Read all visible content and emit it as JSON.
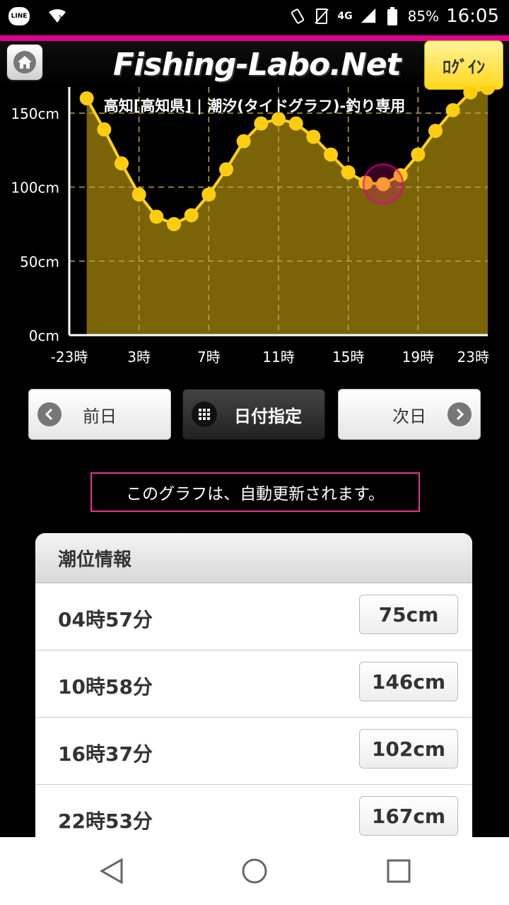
{
  "status_bar": {
    "line_label": "LINE",
    "network": "4G",
    "battery": "85%",
    "time": "16:05"
  },
  "header": {
    "logo": "Fishing-Labo.Net",
    "login_label": "ﾛｸﾞｲﾝ"
  },
  "chart_title": "高知[高知県] | 潮汐(タイドグラフ)-釣り専用",
  "chart_data": {
    "type": "area",
    "y_ticks": [
      "150cm",
      "100cm",
      "50cm",
      "0cm"
    ],
    "y_tick_values": [
      150,
      100,
      50,
      0
    ],
    "ylim": [
      0,
      160
    ],
    "x_ticks": [
      "-23時",
      "3時",
      "7時",
      "11時",
      "15時",
      "19時",
      "23時"
    ],
    "x_tick_values": [
      -1,
      3,
      7,
      11,
      15,
      19,
      23
    ],
    "xlim": [
      -1,
      23
    ],
    "grid": true,
    "area_color": "#7b6408",
    "line_color": "#ffd21a",
    "marker_color": "#ffcd10",
    "highlight_color": "#e0008a",
    "current_index": 17,
    "series": [
      {
        "x": [
          0,
          1,
          2,
          3,
          4,
          5,
          6,
          7,
          8,
          9,
          10,
          11,
          12,
          13,
          14,
          15,
          16,
          17,
          18,
          19,
          20,
          21,
          22,
          23
        ],
        "values": [
          160,
          139,
          116,
          95,
          80,
          75,
          81,
          95,
          112,
          131,
          143,
          146,
          143,
          134,
          122,
          110,
          103,
          102,
          108,
          122,
          138,
          152,
          164,
          167
        ]
      }
    ]
  },
  "nav": {
    "prev": "前日",
    "date": "日付指定",
    "next": "次日"
  },
  "notice": "このグラフは、自動更新されます。",
  "tide_info": {
    "title": "潮位情報",
    "rows": [
      {
        "time": "04時57分",
        "value": "75cm"
      },
      {
        "time": "10時58分",
        "value": "146cm"
      },
      {
        "time": "16時37分",
        "value": "102cm"
      },
      {
        "time": "22時53分",
        "value": "167cm"
      }
    ]
  }
}
